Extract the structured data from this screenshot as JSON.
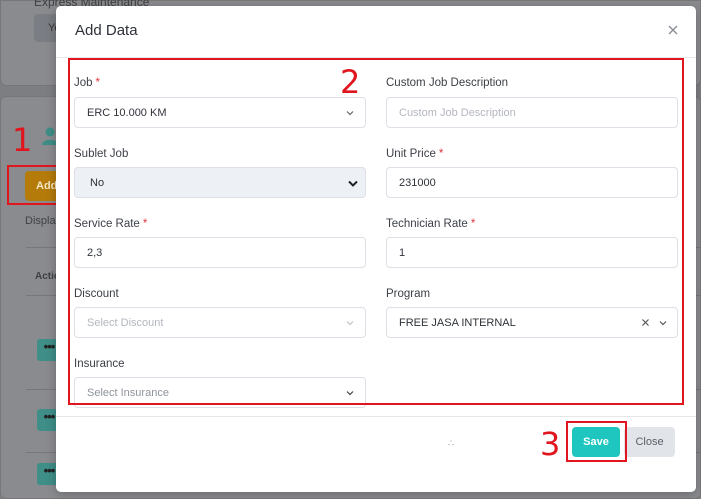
{
  "background": {
    "top_label": "Express Maintenance",
    "top_button": "Ye",
    "add_button": "Add",
    "display_label": "Displa",
    "action_header": "Actio"
  },
  "modal": {
    "title": "Add Data",
    "fields": {
      "job": {
        "label": "Job",
        "value": "ERC 10.000 KM"
      },
      "custom_job_description": {
        "label": "Custom Job Description",
        "placeholder": "Custom Job Description"
      },
      "sublet_job": {
        "label": "Sublet Job",
        "value": "No"
      },
      "unit_price": {
        "label": "Unit Price",
        "value": "231000"
      },
      "service_rate": {
        "label": "Service Rate",
        "value": "2,3"
      },
      "technician_rate": {
        "label": "Technician Rate",
        "value": "1"
      },
      "discount": {
        "label": "Discount",
        "placeholder": "Select Discount"
      },
      "program": {
        "label": "Program",
        "value": "FREE JASA INTERNAL"
      },
      "insurance": {
        "label": "Insurance",
        "placeholder": "Select Insurance"
      }
    },
    "required_mark": "*",
    "save_label": "Save",
    "close_label": "Close"
  },
  "annotations": {
    "one": "1",
    "two": "2",
    "three": "3"
  },
  "colors": {
    "accent": "#1fc6bf",
    "annotation": "#e0151d",
    "required": "#e3343b"
  }
}
